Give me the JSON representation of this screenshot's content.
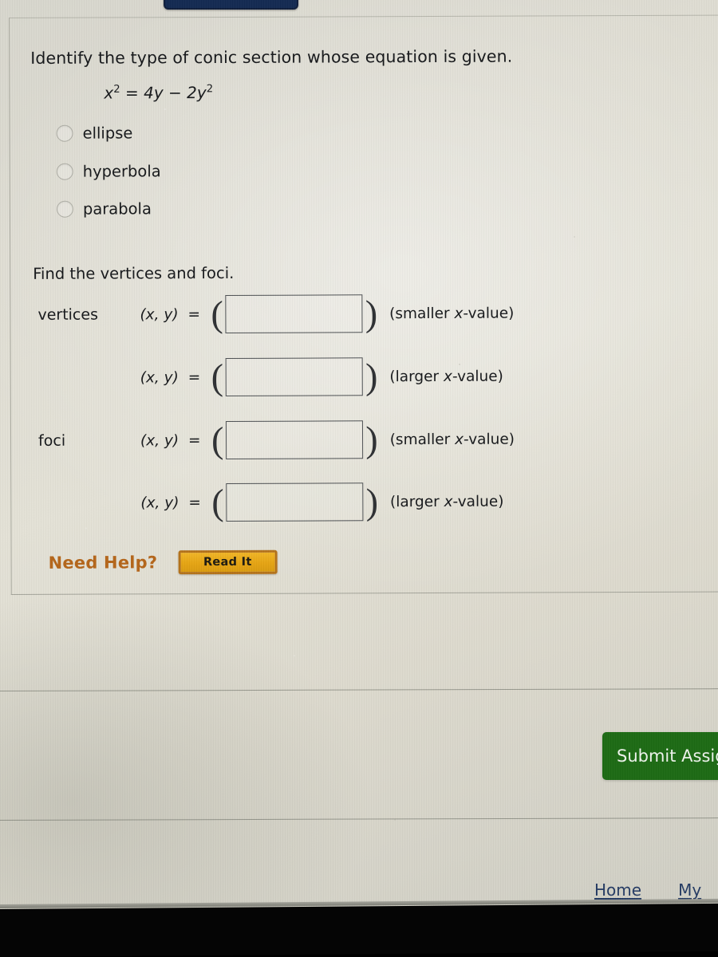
{
  "question": {
    "prompt": "Identify the type of conic section whose equation is given.",
    "equation": {
      "lhs_base": "x",
      "lhs_exp": "2",
      "equals": "=",
      "term1": "4y",
      "minus": "−",
      "term2_base": "2y",
      "term2_exp": "2",
      "plain": "x2 = 4y − 2y2"
    },
    "options": [
      {
        "label": "ellipse",
        "selected": false
      },
      {
        "label": "hyperbola",
        "selected": false
      },
      {
        "label": "parabola",
        "selected": false
      }
    ]
  },
  "find_section": {
    "heading": "Find the vertices and foci.",
    "rows": [
      {
        "name": "vertices",
        "coord": "(x, y)",
        "equals": "=",
        "value": "",
        "note_prefix": "(smaller ",
        "note_italic": "x",
        "note_suffix": "-value)"
      },
      {
        "name": "",
        "coord": "(x, y)",
        "equals": "=",
        "value": "",
        "note_prefix": "(larger ",
        "note_italic": "x",
        "note_suffix": "-value)"
      },
      {
        "name": "foci",
        "coord": "(x, y)",
        "equals": "=",
        "value": "",
        "note_prefix": "(smaller ",
        "note_italic": "x",
        "note_suffix": "-value)"
      },
      {
        "name": "",
        "coord": "(x, y)",
        "equals": "=",
        "value": "",
        "note_prefix": "(larger ",
        "note_italic": "x",
        "note_suffix": "-value)"
      }
    ],
    "open_paren": "(",
    "close_paren": ")"
  },
  "help": {
    "label": "Need Help?",
    "read_it_label": "Read It",
    "label_color": "#b4651a",
    "button_color": "#e5a413"
  },
  "actions": {
    "submit_label": "Submit Assig",
    "submit_color": "#1d6a14"
  },
  "footer": {
    "links": [
      {
        "label": "Home"
      },
      {
        "label": "My"
      }
    ],
    "link_color": "#243a63"
  }
}
